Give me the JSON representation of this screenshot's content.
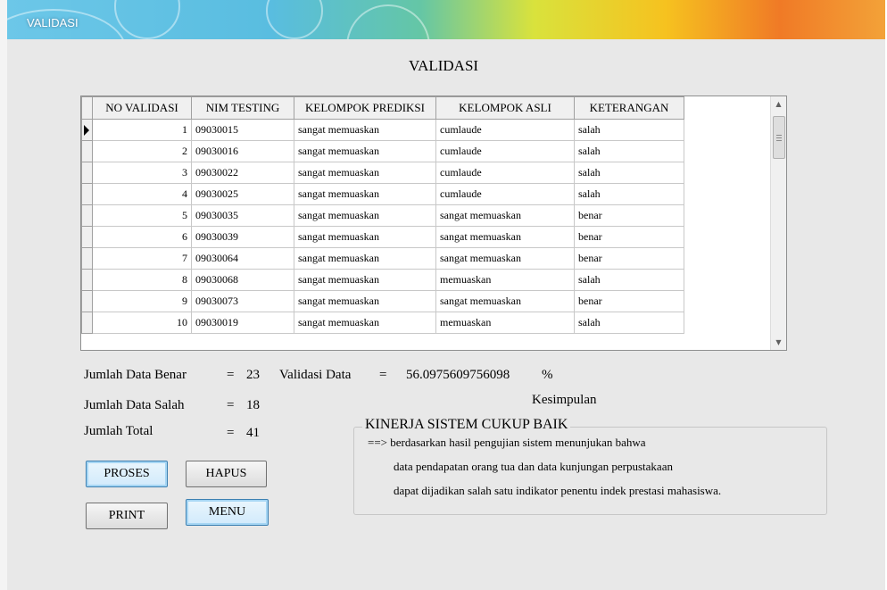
{
  "window": {
    "title": "VALIDASI"
  },
  "heading": "VALIDASI",
  "grid": {
    "columns": [
      "NO VALIDASI",
      "NIM TESTING",
      "KELOMPOK PREDIKSI",
      "KELOMPOK ASLI",
      "KETERANGAN"
    ],
    "rows": [
      [
        "1",
        "09030015",
        "sangat memuaskan",
        "cumlaude",
        "salah"
      ],
      [
        "2",
        "09030016",
        "sangat memuaskan",
        "cumlaude",
        "salah"
      ],
      [
        "3",
        "09030022",
        "sangat memuaskan",
        "cumlaude",
        "salah"
      ],
      [
        "4",
        "09030025",
        "sangat memuaskan",
        "cumlaude",
        "salah"
      ],
      [
        "5",
        "09030035",
        "sangat memuaskan",
        "sangat memuaskan",
        "benar"
      ],
      [
        "6",
        "09030039",
        "sangat memuaskan",
        "sangat memuaskan",
        "benar"
      ],
      [
        "7",
        "09030064",
        "sangat memuaskan",
        "sangat memuaskan",
        "benar"
      ],
      [
        "8",
        "09030068",
        "sangat memuaskan",
        "memuaskan",
        "salah"
      ],
      [
        "9",
        "09030073",
        "sangat memuaskan",
        "sangat memuaskan",
        "benar"
      ],
      [
        "10",
        "09030019",
        "sangat memuaskan",
        "memuaskan",
        "salah"
      ]
    ]
  },
  "stats": {
    "benar_label": "Jumlah Data Benar",
    "benar_eq": "=",
    "benar_value": "23",
    "salah_label": "Jumlah Data Salah",
    "salah_eq": "=",
    "salah_value": "18",
    "total_label": "Jumlah Total",
    "total_eq": "=",
    "total_value": "41",
    "validasi_label": "Validasi Data",
    "validasi_eq": "=",
    "validasi_value": "56.0975609756098",
    "validasi_unit": "%"
  },
  "buttons": {
    "proses": "PROSES",
    "hapus": "HAPUS",
    "print": "PRINT",
    "menu": "MENU"
  },
  "kesimpulan": {
    "label": "Kesimpulan",
    "title": "KINERJA SISTEM CUKUP BAIK",
    "line1": "==>  berdasarkan hasil pengujian sistem menunjukan bahwa",
    "line2": "data pendapatan orang tua dan data kunjungan perpustakaan",
    "line3": "dapat dijadikan salah satu indikator penentu indek prestasi mahasiswa."
  },
  "icons": {
    "row_selector": "selector-arrow-icon",
    "scroll_up": "scroll-up-icon",
    "scroll_down": "scroll-down-icon"
  }
}
